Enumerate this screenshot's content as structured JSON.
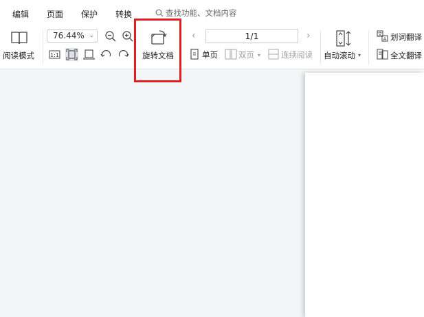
{
  "menubar": {
    "items": [
      "编辑",
      "页面",
      "保护",
      "转换"
    ],
    "search_placeholder": "查找功能、文档内容"
  },
  "ribbon": {
    "read_mode_label": "阅读模式",
    "zoom_value": "76.44%",
    "rotate_doc_label": "旋转文档",
    "page_indicator": "1/1",
    "single_page_label": "单页",
    "double_page_label": "双页",
    "continuous_label": "连续阅读",
    "auto_scroll_label": "自动滚动",
    "word_translate_label": "划词翻译",
    "full_translate_label": "全文翻译"
  },
  "colors": {
    "highlight": "#e02020",
    "background": "#f4f5f7"
  }
}
